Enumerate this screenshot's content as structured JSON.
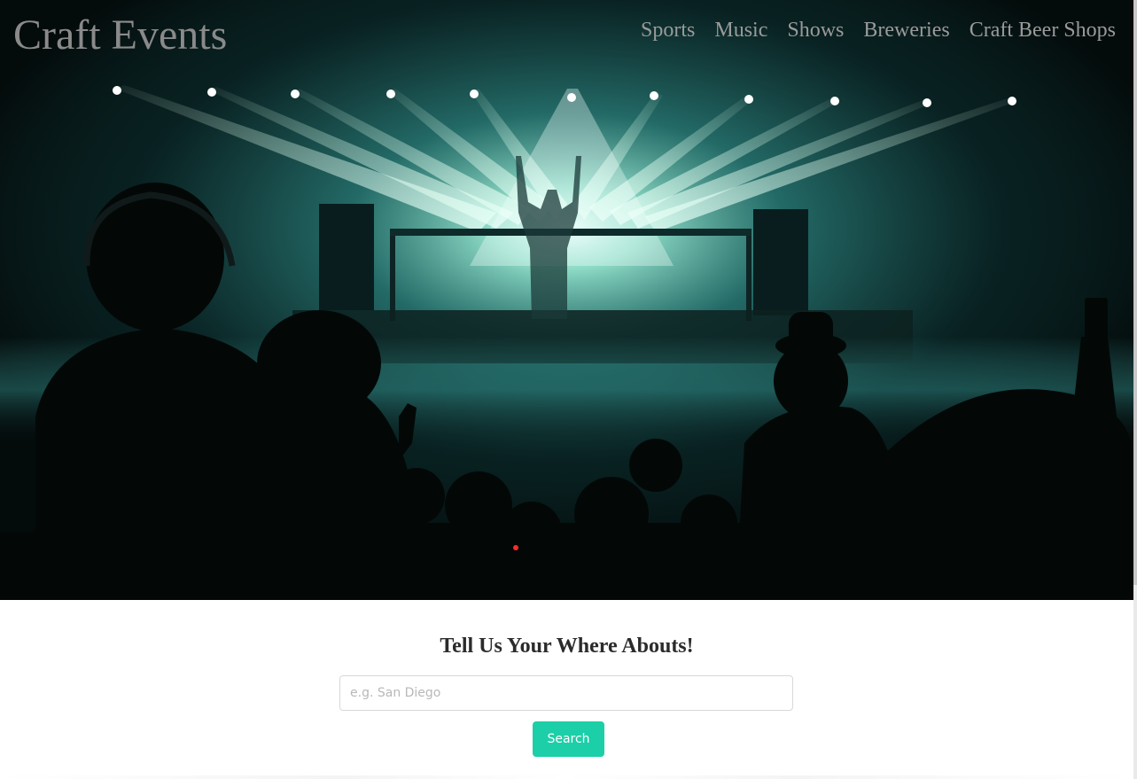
{
  "header": {
    "brand": "Craft Events",
    "nav": [
      {
        "label": "Sports"
      },
      {
        "label": "Music"
      },
      {
        "label": "Shows"
      },
      {
        "label": "Breweries"
      },
      {
        "label": "Craft Beer Shops"
      }
    ]
  },
  "search": {
    "heading": "Tell Us Your Where Abouts!",
    "placeholder": "e.g. San Diego",
    "value": "",
    "button_label": "Search"
  },
  "colors": {
    "accent": "#1ccfa8",
    "nav_text": "#9a9a9a",
    "hero_light": "#a8ffe6"
  }
}
